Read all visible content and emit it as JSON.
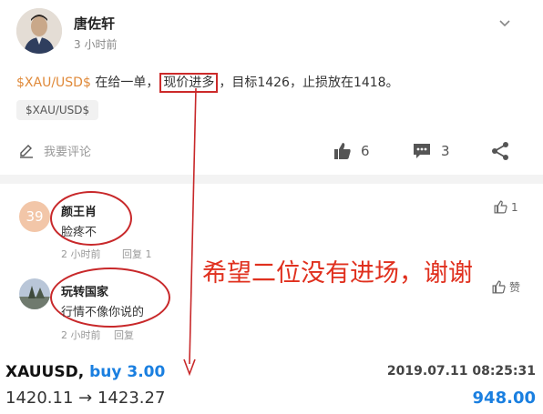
{
  "post": {
    "author": "唐佐轩",
    "time": "3 小时前",
    "text_ticker": "$XAU/USD$",
    "text_part1": " 在给一单，",
    "text_highlight": "现价进多",
    "text_part2": "，目标1426，止损放在1418。",
    "tag": "$XAU/USD$"
  },
  "actions": {
    "comment_placeholder": "我要评论",
    "likes": "6",
    "comments": "3",
    "icons": [
      "edit-icon",
      "thumbs-up-icon",
      "comment-icon",
      "share-icon"
    ]
  },
  "comments": [
    {
      "avatar_text": "39",
      "avatar_color": "#f2c6a8",
      "name": "颜王肖",
      "text": "脸疼不",
      "time": "2 小时前",
      "reply": "回复 1",
      "likes": "1"
    },
    {
      "name": "玩转国家",
      "text": "行情不像你说的",
      "time": "2 小时前",
      "reply": "回复",
      "likes": "赞"
    }
  ],
  "annotation": {
    "note": "希望二位没有进场，谢谢",
    "color": "#e0301e"
  },
  "trade": {
    "symbol": "XAUUSD,",
    "side": "buy 3.00",
    "datetime": "2019.07.11 08:25:31",
    "prices": "1420.11 → 1423.27",
    "profit": "948.00",
    "profit_color": "#1a7fe0"
  }
}
